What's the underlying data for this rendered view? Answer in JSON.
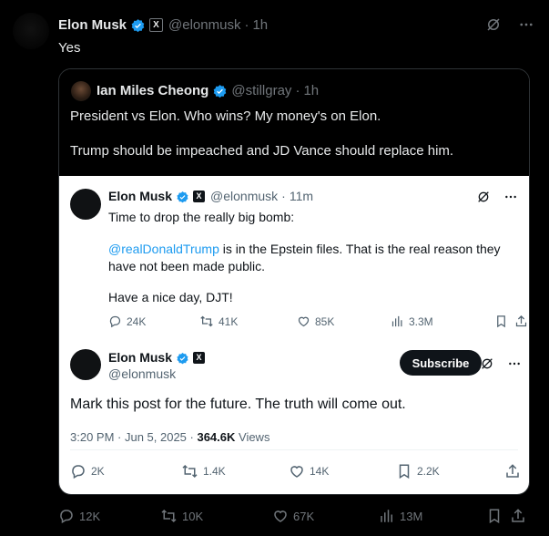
{
  "outer": {
    "name": "Elon Musk",
    "x_badge": "X",
    "handle": "@elonmusk",
    "dot": "·",
    "time": "1h",
    "text": "Yes",
    "stats": {
      "replies": "12K",
      "reposts": "10K",
      "likes": "67K",
      "views": "13M"
    }
  },
  "quote": {
    "name": "Ian Miles Cheong",
    "handle": "@stillgray",
    "dot": "·",
    "time": "1h",
    "text1": "President vs Elon. Who wins? My money's on Elon.",
    "text2": "Trump should be impeached and JD Vance should replace him."
  },
  "embed1": {
    "name": "Elon Musk",
    "x_badge": "X",
    "handle": "@elonmusk",
    "dot": "·",
    "time": "11m",
    "line1": "Time to drop the really big bomb:",
    "mention": "@realDonaldTrump",
    "line2_rest": " is in the Epstein files. That is the real reason they have not been made public.",
    "line3": "Have a nice day, DJT!",
    "stats": {
      "replies": "24K",
      "reposts": "41K",
      "likes": "85K",
      "views": "3.3M"
    }
  },
  "embed2": {
    "name": "Elon Musk",
    "x_badge": "X",
    "handle": "@elonmusk",
    "subscribe_label": "Subscribe",
    "text": "Mark this post for the future. The truth will come out.",
    "time_prefix": "3:20 PM · Jun 5, 2025 · ",
    "views_count": "364.6K",
    "views_label": " Views",
    "stats": {
      "replies": "2K",
      "reposts": "1.4K",
      "likes": "14K",
      "bookmarks": "2.2K"
    }
  },
  "icons": [
    "grok-icon",
    "more-icon",
    "verified-icon",
    "reply-icon",
    "repost-icon",
    "like-icon",
    "views-icon",
    "bookmark-icon",
    "share-icon"
  ],
  "colors": {
    "verified": "#1d9bf0",
    "mention": "#1d9bf0",
    "muted_dark": "#71767b",
    "muted_light": "#536471"
  }
}
